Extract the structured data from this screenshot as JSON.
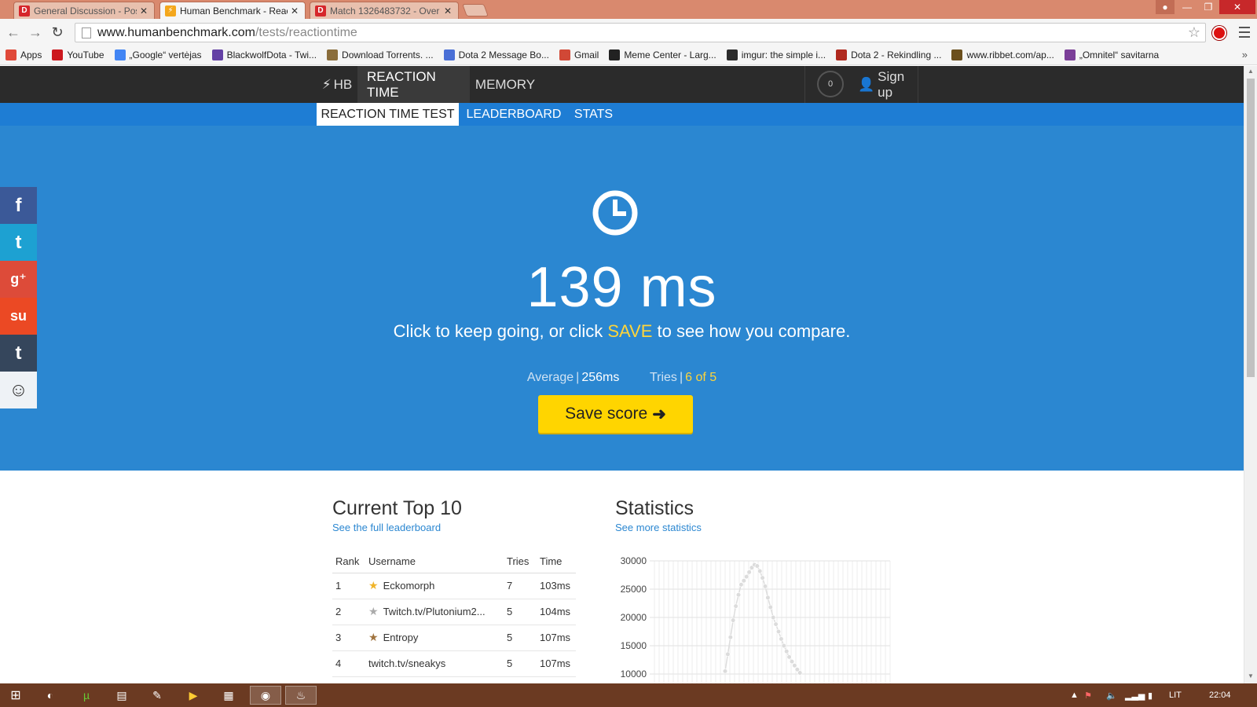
{
  "browser": {
    "tabs": [
      {
        "title": "General Discussion - Post",
        "favicon": "D",
        "active": false
      },
      {
        "title": "Human Benchmark - Reac",
        "favicon": "⚡",
        "active": true
      },
      {
        "title": "Match 1326483732 - Over",
        "favicon": "D",
        "active": false
      }
    ],
    "url_host": "www.humanbenchmark.com",
    "url_path": "/tests/reactiontime",
    "bookmarks": [
      {
        "label": "Apps",
        "color": "#e04a3a"
      },
      {
        "label": "YouTube",
        "color": "#cc181e"
      },
      {
        "label": "„Google“ vertėjas",
        "color": "#4285f4"
      },
      {
        "label": "BlackwolfDota - Twi...",
        "color": "#6441a5"
      },
      {
        "label": "Download Torrents. ...",
        "color": "#8a6d3b"
      },
      {
        "label": "Dota 2 Message Bo...",
        "color": "#4a6fd6"
      },
      {
        "label": "Gmail",
        "color": "#d14836"
      },
      {
        "label": "Meme Center - Larg...",
        "color": "#222222"
      },
      {
        "label": "imgur: the simple i...",
        "color": "#2b2b2b"
      },
      {
        "label": "Dota 2 - Rekindling ...",
        "color": "#b0291e"
      },
      {
        "label": "www.ribbet.com/ap...",
        "color": "#6b4f1d"
      },
      {
        "label": "„Omnitel“ savitarna",
        "color": "#7b3f98"
      }
    ],
    "bookmarks_more": "»"
  },
  "site": {
    "nav": {
      "brand": "HB",
      "items": [
        "REACTION TIME",
        "MEMORY"
      ],
      "badge": "0",
      "signup": "Sign up"
    },
    "subnav": [
      "REACTION TIME TEST",
      "LEADERBOARD",
      "STATS"
    ],
    "hero": {
      "score": "139 ms",
      "msg_before": "Click to keep going, or click ",
      "msg_highlight": "SAVE",
      "msg_after": " to see how you compare.",
      "average_label": "Average",
      "average_value": "256ms",
      "tries_label": "Tries",
      "tries_value": "6 of 5",
      "save_label": "Save score"
    },
    "social": [
      {
        "name": "facebook",
        "glyph": "f",
        "color": "#3b5998"
      },
      {
        "name": "twitter",
        "glyph": "t",
        "color": "#1da1d2"
      },
      {
        "name": "googleplus",
        "glyph": "g⁺",
        "color": "#dd4b39"
      },
      {
        "name": "stumbleupon",
        "glyph": "su",
        "color": "#eb4924"
      },
      {
        "name": "tumblr",
        "glyph": "t",
        "color": "#35465c"
      },
      {
        "name": "reddit",
        "glyph": "☺",
        "color": "#eef2f6"
      }
    ],
    "leaderboard": {
      "title": "Current Top 10",
      "link": "See the full leaderboard",
      "headers": [
        "Rank",
        "Username",
        "Tries",
        "Time"
      ],
      "rows": [
        {
          "rank": "1",
          "username": "Eckomorph",
          "tries": "7",
          "time": "103ms",
          "star": "gold"
        },
        {
          "rank": "2",
          "username": "Twitch.tv/Plutonium2...",
          "tries": "5",
          "time": "104ms",
          "star": "silver"
        },
        {
          "rank": "3",
          "username": "Entropy",
          "tries": "5",
          "time": "107ms",
          "star": "bronze"
        },
        {
          "rank": "4",
          "username": "twitch.tv/sneakys",
          "tries": "5",
          "time": "107ms",
          "star": "none"
        }
      ]
    },
    "statistics": {
      "title": "Statistics",
      "link": "See more statistics"
    }
  },
  "chart_data": {
    "type": "line",
    "title": "",
    "xlabel": "",
    "ylabel": "",
    "y_ticks": [
      30000,
      25000,
      20000,
      15000,
      10000
    ],
    "ylim": [
      10000,
      30000
    ],
    "grid": true,
    "legend": "none",
    "series": [
      {
        "values": [
          10500,
          13500,
          16500,
          19500,
          22000,
          24000,
          25800,
          26500,
          27200,
          28000,
          28800,
          29300,
          29100,
          28200,
          27000,
          25500,
          23500,
          21800,
          20000,
          18800,
          17500,
          16200,
          15000,
          14000,
          13000,
          12200,
          11500,
          10800,
          10200
        ]
      }
    ]
  },
  "taskbar": {
    "tray_lang": "LIT",
    "clock": "22:04"
  },
  "colors": {
    "hero_blue": "#2b87d1",
    "subnav_blue": "#1e7dd4",
    "nav_dark": "#2b2b2b",
    "accent_yellow": "#ffd500",
    "highlight_yellow": "#ffd53a"
  }
}
